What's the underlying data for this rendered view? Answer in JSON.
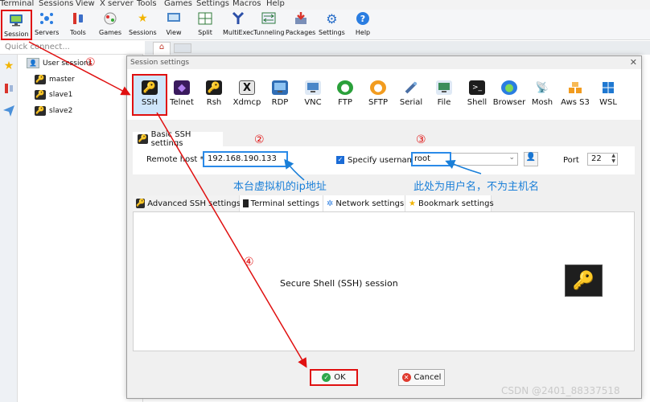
{
  "menubar": [
    "Terminal",
    "Sessions",
    "View",
    "X server",
    "Tools",
    "Games",
    "Settings",
    "Macros",
    "Help"
  ],
  "toolbar": [
    {
      "label": "Session",
      "icon": "monitor-icon"
    },
    {
      "label": "Servers",
      "icon": "servers-icon"
    },
    {
      "label": "Tools",
      "icon": "tools-icon"
    },
    {
      "label": "Games",
      "icon": "games-icon"
    },
    {
      "label": "Sessions",
      "icon": "star-icon"
    },
    {
      "label": "View",
      "icon": "view-icon"
    },
    {
      "label": "Split",
      "icon": "split-icon"
    },
    {
      "label": "MultiExec",
      "icon": "multiexec-icon"
    },
    {
      "label": "Tunneling",
      "icon": "tunneling-icon"
    },
    {
      "label": "Packages",
      "icon": "packages-icon"
    },
    {
      "label": "Settings",
      "icon": "gear-icon"
    },
    {
      "label": "Help",
      "icon": "help-icon"
    }
  ],
  "quick_connect": {
    "placeholder": "Quick connect..."
  },
  "sessions_tree": {
    "root": "User sessions",
    "items": [
      "master",
      "slave1",
      "slave2"
    ]
  },
  "dialog": {
    "title": "Session settings",
    "close": "✕",
    "protocols": [
      "SSH",
      "Telnet",
      "Rsh",
      "Xdmcp",
      "RDP",
      "VNC",
      "FTP",
      "SFTP",
      "Serial",
      "File",
      "Shell",
      "Browser",
      "Mosh",
      "Aws S3",
      "WSL"
    ],
    "basic_tab": "Basic SSH settings",
    "remote_host_label": "Remote host *",
    "remote_host_value": "192.168.190.133",
    "specify_username_label": "Specify username",
    "username_value": "root",
    "port_label": "Port",
    "port_value": "22",
    "sub_tabs": [
      "Advanced SSH settings",
      "Terminal settings",
      "Network settings",
      "Bookmark settings"
    ],
    "description": "Secure Shell (SSH) session",
    "ok_label": "OK",
    "cancel_label": "Cancel"
  },
  "annotations": {
    "n1": "①",
    "n2": "②",
    "n3": "③",
    "n4": "④",
    "note_host": "本台虚拟机的ip地址",
    "note_user": "此处为用户名，不为主机名"
  },
  "colors": {
    "annotation_red": "#e01010",
    "annotation_blue": "#1a7fd8",
    "selected_tab": "#cfe6fb"
  },
  "watermark": "CSDN @2401_88337518"
}
